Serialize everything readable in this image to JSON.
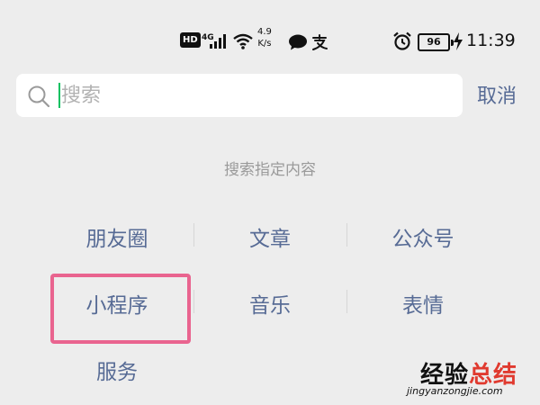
{
  "status_bar": {
    "hd": "HD",
    "network": "4G",
    "speed_value": "4.9",
    "speed_unit": "K/s",
    "battery": "96",
    "time": "11:39",
    "icons": [
      "signal-icon",
      "wifi-icon",
      "chat-icon",
      "alipay-icon",
      "alarm-icon",
      "charging-icon"
    ]
  },
  "search": {
    "placeholder": "搜索",
    "value": "",
    "cancel_label": "取消"
  },
  "hint": "搜索指定内容",
  "categories": {
    "moments": "朋友圈",
    "articles": "文章",
    "official_accounts": "公众号",
    "mini_programs": "小程序",
    "music": "音乐",
    "stickers": "表情",
    "services": "服务"
  },
  "watermark": {
    "title_part1": "经验",
    "title_part2": "总结",
    "url": "jingyanzongjie.com"
  },
  "colors": {
    "link": "#576b95",
    "highlight": "#e9648f",
    "caret": "#07c160",
    "background": "#ededed"
  }
}
